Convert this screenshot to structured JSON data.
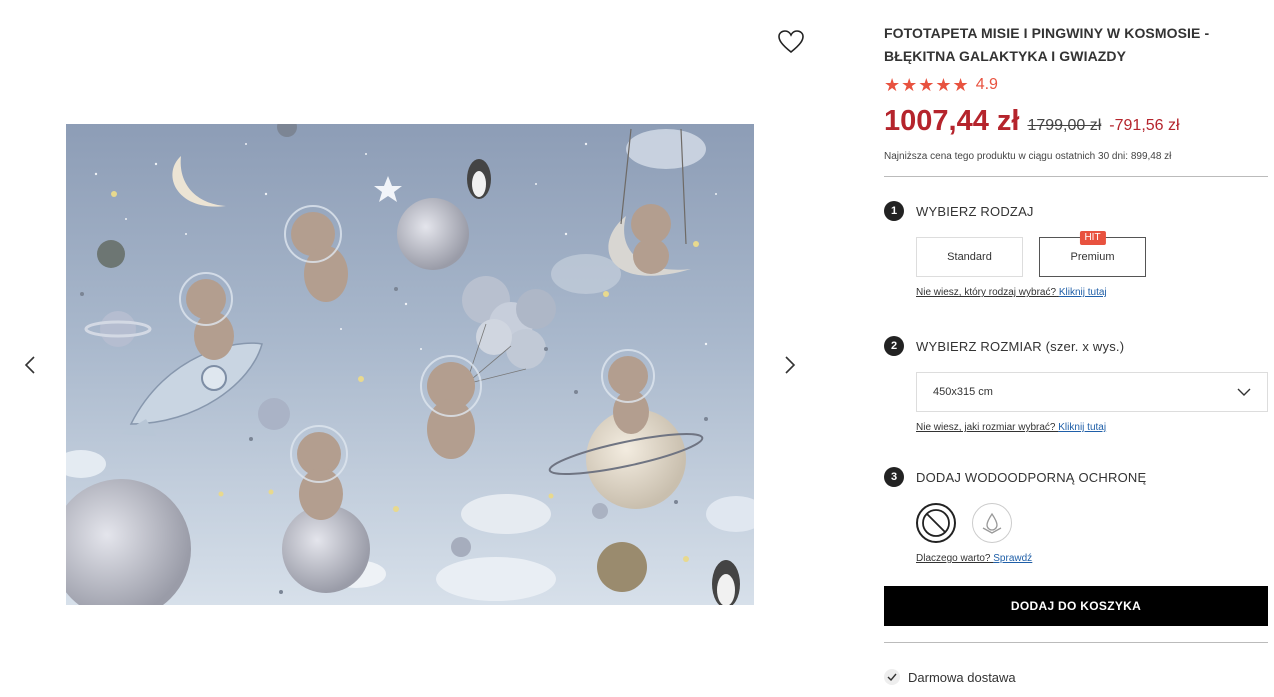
{
  "product": {
    "title": "FOTOTAPETA MISIE I PINGWINY W KOSMOSIE - BŁĘKITNA GALAKTYKA I GWIAZDY",
    "rating": "4.9",
    "stars": "★★★★★",
    "price_current": "1007,44 zł",
    "price_old": "1799,00 zł",
    "price_diff": "-791,56 zł",
    "lowest_price_note": "Najniższa cena tego produktu w ciągu ostatnich 30 dni: 899,48 zł"
  },
  "step1": {
    "number": "1",
    "title": "WYBIERZ RODZAJ",
    "options": [
      {
        "label": "Standard"
      },
      {
        "label": "Premium",
        "badge": "HIT"
      }
    ],
    "help_text": "Nie wiesz, który rodzaj wybrać?",
    "help_link": "Kliknij tutaj"
  },
  "step2": {
    "number": "2",
    "title": "WYBIERZ ROZMIAR",
    "subtitle": "(szer. x wys.)",
    "selected_size": "450x315 cm",
    "help_text": "Nie wiesz, jaki rozmiar wybrać?",
    "help_link": "Kliknij tutaj"
  },
  "step3": {
    "number": "3",
    "title": "DODAJ WODOODPORNĄ OCHRONĘ",
    "help_text": "Dlaczego warto?",
    "help_link": "Sprawdź"
  },
  "cart": {
    "add_label": "DODAJ DO KOSZYKA"
  },
  "delivery": {
    "label": "Darmowa dostawa"
  },
  "colors": {
    "accent_red": "#b5242c",
    "star_color": "#e8523f",
    "button_black": "#000000"
  }
}
